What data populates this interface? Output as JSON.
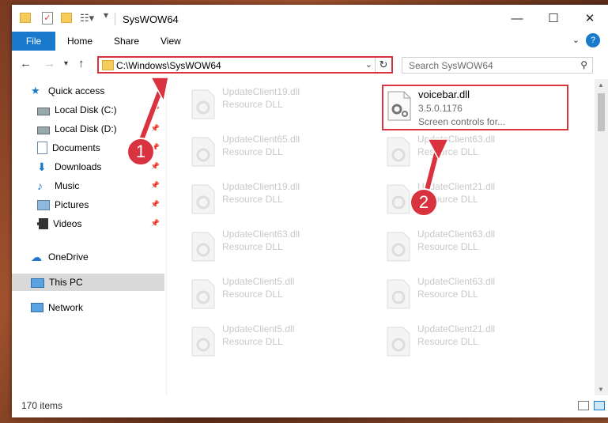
{
  "window": {
    "title": "SysWOW64"
  },
  "ribbon": {
    "tabs": [
      "File",
      "Home",
      "Share",
      "View"
    ],
    "help": "?"
  },
  "address": {
    "path": "C:\\Windows\\SysWOW64"
  },
  "search": {
    "placeholder": "Search SysWOW64"
  },
  "sidebar": {
    "items": [
      {
        "label": "Quick access",
        "pinned": false
      },
      {
        "label": "Local Disk (C:)",
        "pinned": true
      },
      {
        "label": "Local Disk (D:)",
        "pinned": true
      },
      {
        "label": "Documents",
        "pinned": true
      },
      {
        "label": "Downloads",
        "pinned": true
      },
      {
        "label": "Music",
        "pinned": true
      },
      {
        "label": "Pictures",
        "pinned": true
      },
      {
        "label": "Videos",
        "pinned": true
      },
      {
        "label": "OneDrive",
        "pinned": false
      },
      {
        "label": "This PC",
        "pinned": false,
        "selected": true
      },
      {
        "label": "Network",
        "pinned": false
      }
    ]
  },
  "files": {
    "left": [
      {
        "name": "UpdateClient19.dll",
        "type": "Resource DLL"
      },
      {
        "name": "UpdateClient65.dll",
        "type": "Resource DLL"
      },
      {
        "name": "UpdateClient19.dll",
        "type": "Resource DLL"
      },
      {
        "name": "UpdateClient63.dll",
        "type": "Resource DLL"
      },
      {
        "name": "UpdateClient5.dll",
        "type": "Resource DLL"
      },
      {
        "name": "UpdateClient5.dll",
        "type": "Resource DLL"
      }
    ],
    "right": [
      {
        "name": "UpdateClient63.dll",
        "type": "Resource DLL"
      },
      {
        "name": "UpdateClient21.dll",
        "type": "Resource DLL"
      },
      {
        "name": "UpdateClient63.dll",
        "type": "Resource DLL"
      },
      {
        "name": "UpdateClient63.dll",
        "type": "Resource DLL"
      },
      {
        "name": "UpdateClient21.dll",
        "type": "Resource DLL"
      }
    ],
    "selected": {
      "name": "voicebar.dll",
      "version": "3.5.0.1176",
      "description": "Screen controls for..."
    }
  },
  "annotations": {
    "step1": "1",
    "step2": "2",
    "color": "#d9333f"
  },
  "status": {
    "item_count": "170 items"
  }
}
